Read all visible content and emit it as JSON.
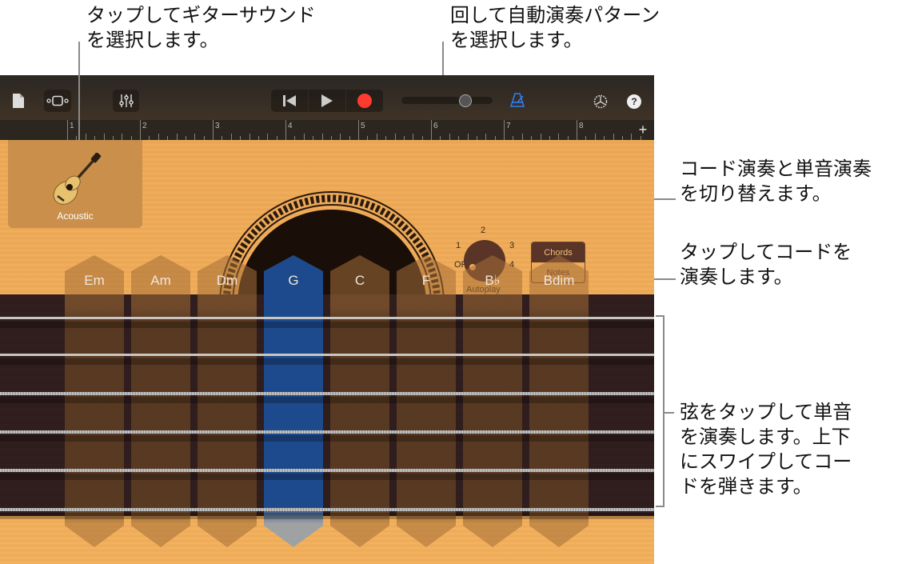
{
  "callouts": {
    "guitar_sound": "タップしてギターサウンド\nを選択します。",
    "autoplay": "回して自動演奏パターン\nを選択します。",
    "chords_notes": "コード演奏と単音演奏\nを切り替えます。",
    "chord_strips": "タップしてコードを\n演奏します。",
    "strings": "弦をタップして単音\nを演奏します。上下\nにスワイプしてコー\nドを弾きます。"
  },
  "toolbar": {
    "my_songs_icon": "document-icon",
    "view_icon": "track-view-icon",
    "mixer_icon": "mixer-sliders-icon",
    "rewind_icon": "skip-back-icon",
    "play_icon": "play-icon",
    "record_icon": "record-icon",
    "metronome_icon": "metronome-icon",
    "settings_icon": "gear-icon",
    "help_label": "?",
    "volume_level": 0.72,
    "colors": {
      "record": "#ff3b30",
      "metronome": "#2f7ff0"
    }
  },
  "ruler": {
    "bars": [
      "1",
      "2",
      "3",
      "4",
      "5",
      "6",
      "7",
      "8"
    ],
    "add_label": "+"
  },
  "instrument": {
    "name": "Acoustic"
  },
  "autoplay": {
    "label": "Autoplay",
    "positions": [
      "OFF",
      "1",
      "2",
      "3",
      "4"
    ],
    "selected": "OFF"
  },
  "mode_switch": {
    "options": [
      "Chords",
      "Notes"
    ],
    "selected": "Chords"
  },
  "chords": {
    "items": [
      {
        "label": "Em",
        "selected": false
      },
      {
        "label": "Am",
        "selected": false
      },
      {
        "label": "Dm",
        "selected": false
      },
      {
        "label": "G",
        "selected": true
      },
      {
        "label": "C",
        "selected": false
      },
      {
        "label": "F",
        "selected": false
      },
      {
        "label": "B♭",
        "selected": false
      },
      {
        "label": "Bdim",
        "selected": false
      }
    ],
    "colors": {
      "normal": "#5a3a20",
      "selected": "#1d4a8c"
    }
  },
  "strings": {
    "count": 6
  }
}
